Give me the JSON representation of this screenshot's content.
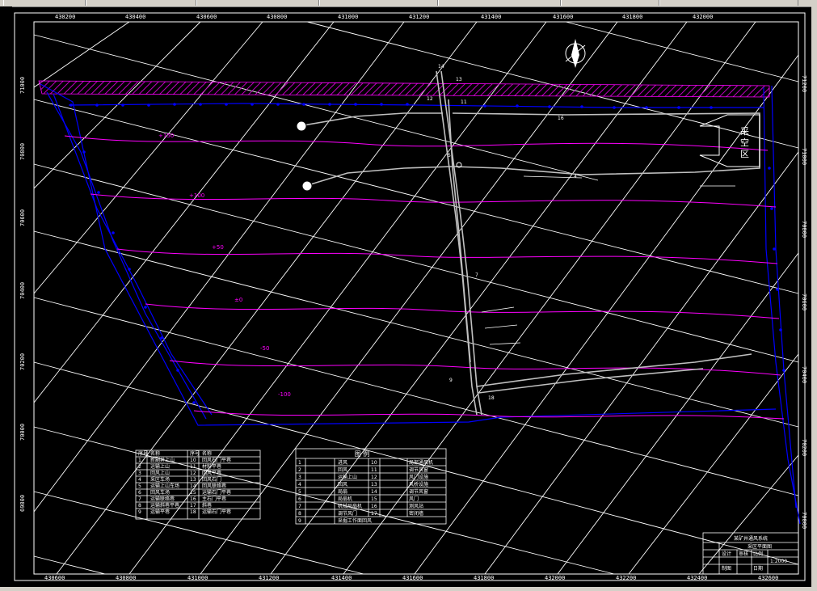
{
  "grid": {
    "top_labels": [
      "430200",
      "430400",
      "430600",
      "430800",
      "431000",
      "431200",
      "431400",
      "431600",
      "431800",
      "432000"
    ],
    "bottom_labels": [
      "430600",
      "430800",
      "431000",
      "431200",
      "431400",
      "431600",
      "431800",
      "432000",
      "432200",
      "432400",
      "432600"
    ],
    "left_labels": [
      "71000",
      "70800",
      "70600",
      "70400",
      "70200",
      "70000",
      "69800"
    ],
    "right_labels": [
      "71200",
      "71000",
      "70800",
      "70600",
      "70400",
      "70200",
      "70000"
    ]
  },
  "contours": [
    "+150",
    "+100",
    "+50",
    "±0",
    "-50",
    "-100"
  ],
  "map_labels": {
    "mining_area": [
      "采",
      "空",
      "区"
    ],
    "shaft_labels": [
      "14",
      "13",
      "12",
      "11",
      "5",
      "7",
      "18",
      "16",
      "4",
      "9"
    ]
  },
  "legend_left": {
    "headers": [
      "序号",
      "名称",
      "序号",
      "名称"
    ],
    "rows": [
      [
        "1",
        "新副井上山",
        "10",
        "回风石门平巷"
      ],
      [
        "2",
        "运输上山",
        "11",
        "材料平巷"
      ],
      [
        "3",
        "回风上山",
        "12",
        "回风平巷"
      ],
      [
        "4",
        "采区车场",
        "13",
        "回风石门"
      ],
      [
        "5",
        "运输上山车场",
        "14",
        "回风联络巷"
      ],
      [
        "6",
        "回风车场",
        "15",
        "运输石门平巷"
      ],
      [
        "7",
        "运输联络巷",
        "16",
        "主石门平巷"
      ],
      [
        "8",
        "运输斜巷平巷",
        "17",
        "斜巷"
      ],
      [
        "9",
        "运输平巷",
        "18",
        "运输石门平巷"
      ]
    ]
  },
  "legend_right": {
    "title": "图  例",
    "rows": [
      [
        "1",
        "进风",
        "10",
        "局部通风机"
      ],
      [
        "2",
        "回风",
        "11",
        "调节风窗"
      ],
      [
        "3",
        "运输上山",
        "12",
        "风门设施"
      ],
      [
        "4",
        "回风",
        "13",
        "风桥设施"
      ],
      [
        "5",
        "局扇",
        "14",
        "调节风窗"
      ],
      [
        "6",
        "局扇机",
        "15",
        "风门"
      ],
      [
        "7",
        "机械局扇机",
        "16",
        "测风站"
      ],
      [
        "8",
        "调节风门",
        "17",
        "密闭墙"
      ],
      [
        "9",
        "采掘工作面回风",
        "",
        ""
      ]
    ]
  },
  "title_block": {
    "title": "某矿井通风系统",
    "subtitle": "采区平面图",
    "row2": [
      "设计",
      "审核",
      "比例",
      "1:2000"
    ],
    "row3": [
      "制图",
      "",
      "日期",
      ""
    ]
  },
  "colors": {
    "grid": "#ffffff",
    "contour": "#ff00ff",
    "boundary": "#0000ff",
    "hatch": "#c000c0",
    "roadway": "#c0c0c0"
  }
}
